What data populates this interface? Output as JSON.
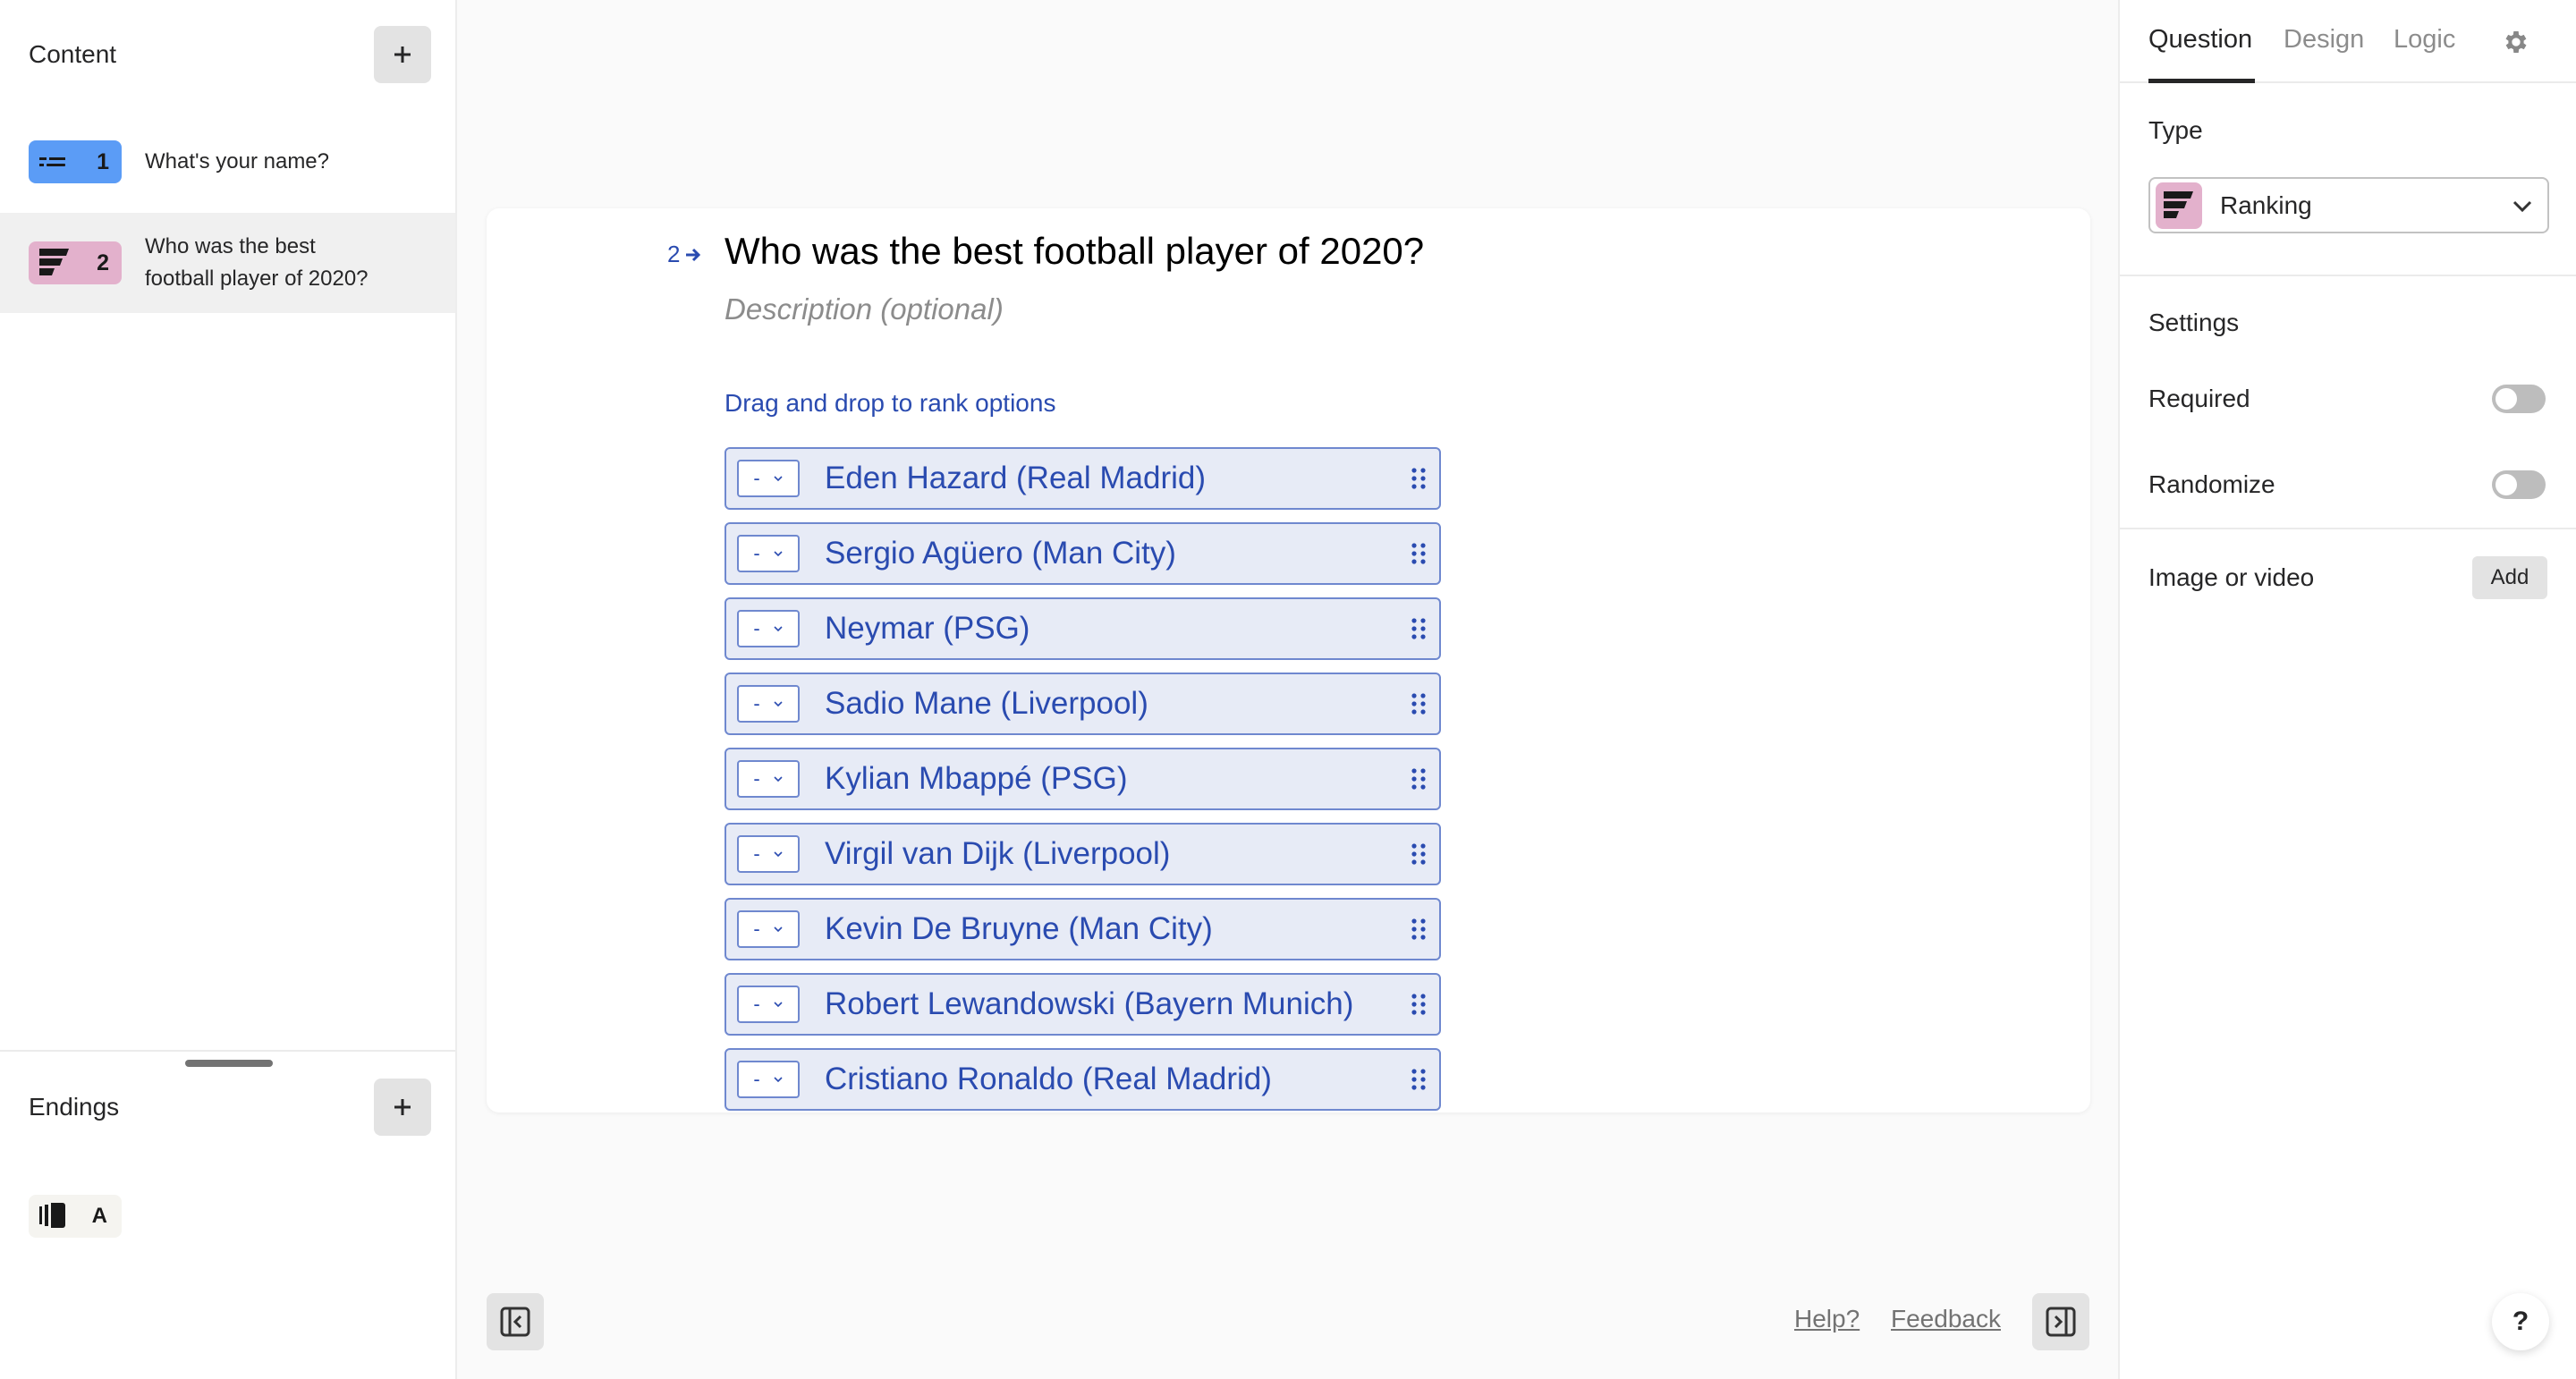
{
  "sidebar": {
    "content_title": "Content",
    "questions": [
      {
        "number": "1",
        "label": "What's your name?",
        "icon": "short-text-icon",
        "color": "#5b9cf6"
      },
      {
        "number": "2",
        "label_line1": "Who was the best",
        "label_line2": "football player of 2020?",
        "icon": "ranking-icon",
        "color": "#e3b1cc"
      }
    ],
    "endings_title": "Endings",
    "endings": [
      {
        "letter": "A",
        "icon": "ending-icon"
      }
    ]
  },
  "question": {
    "number": "2",
    "title": "Who was the best football player of 2020?",
    "description_placeholder": "Description (optional)",
    "hint": "Drag and drop to rank options",
    "rank_placeholder": "-",
    "options": [
      "Eden Hazard (Real Madrid)",
      "Sergio Agüero (Man City)",
      "Neymar (PSG)",
      "Sadio Mane (Liverpool)",
      "Kylian Mbappé (PSG)",
      "Virgil van Dijk (Liverpool)",
      "Kevin De Bruyne (Man City)",
      "Robert Lewandowski (Bayern Munich)",
      "Cristiano Ronaldo (Real Madrid)"
    ]
  },
  "footer": {
    "help": "Help?",
    "feedback": "Feedback"
  },
  "panel": {
    "tabs": [
      "Question",
      "Design",
      "Logic"
    ],
    "active_tab": "Question",
    "type_label": "Type",
    "type_value": "Ranking",
    "settings_label": "Settings",
    "required_label": "Required",
    "required_on": false,
    "randomize_label": "Randomize",
    "randomize_on": false,
    "media_label": "Image or video",
    "media_button": "Add"
  },
  "help_fab": "?",
  "colors": {
    "accent": "#2a4bb0",
    "option_bg": "#e7ebf6",
    "option_border": "#6f88cf",
    "ranking_badge": "#e3b1cc",
    "text_badge": "#5b9cf6"
  }
}
